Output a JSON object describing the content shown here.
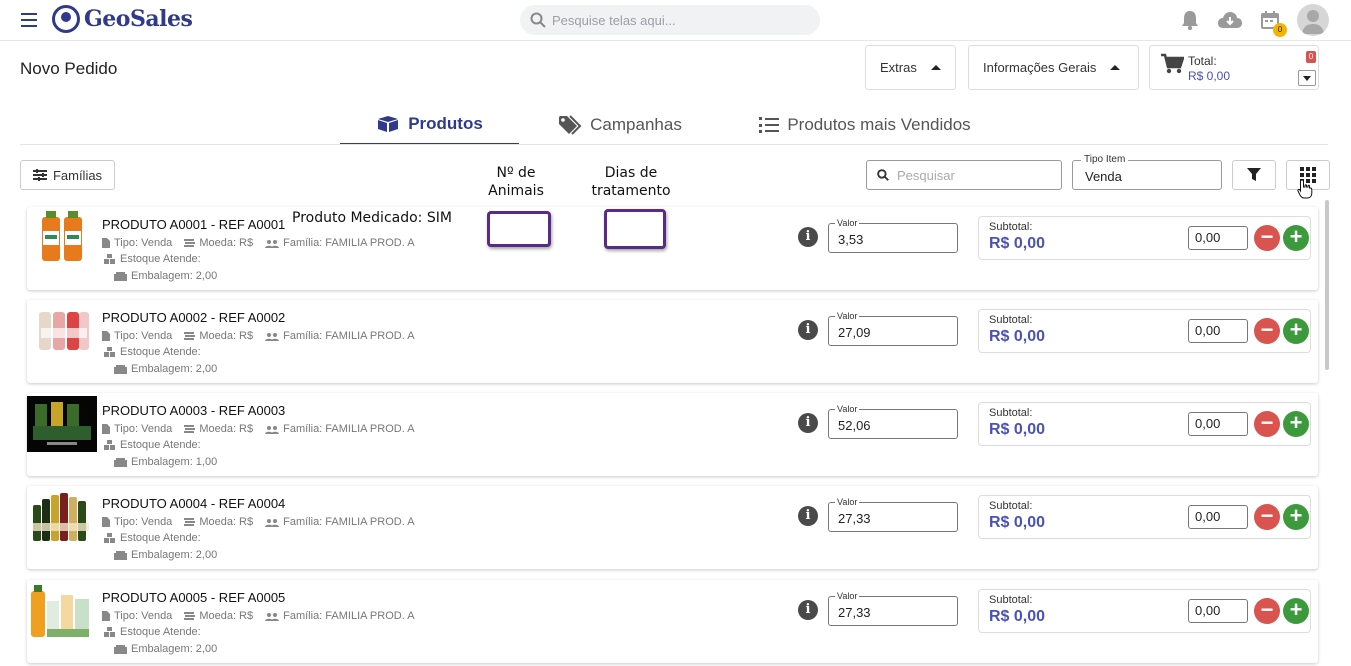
{
  "app": {
    "logo_text": "GeoSales"
  },
  "top": {
    "search_placeholder": "Pesquise telas aqui...",
    "calendar_badge": "0"
  },
  "header": {
    "title": "Novo Pedido",
    "extras_label": "Extras",
    "info_label": "Informações Gerais",
    "total_label": "Total:",
    "total_value": "R$ 0,00",
    "cart_count": "0"
  },
  "tabs": [
    {
      "label": "Produtos",
      "active": true
    },
    {
      "label": "Campanhas",
      "active": false
    },
    {
      "label": "Produtos mais Vendidos",
      "active": false
    }
  ],
  "filters": {
    "familias_label": "Famílias",
    "search_placeholder": "Pesquisar",
    "tipo_label": "Tipo Item",
    "tipo_value": "Venda"
  },
  "annotations": {
    "animals_label": "Nº de Animais",
    "treatment_label": "Dias de tratamento",
    "medicated_label": "Produto Medicado: SIM"
  },
  "products": [
    {
      "name": "PRODUTO A0001 - REF A0001",
      "tipo": "Tipo: Venda",
      "moeda": "Moeda: R$",
      "familia": "Família: FAMILIA PROD. A",
      "estoque": "Estoque Atende:",
      "embalagem": "Embalagem: 2,00",
      "valor_label": "Valor",
      "valor": "3,53",
      "subtotal_label": "Subtotal:",
      "subtotal": "R$ 0,00",
      "qty": "0,00"
    },
    {
      "name": "PRODUTO A0002 - REF A0002",
      "tipo": "Tipo: Venda",
      "moeda": "Moeda: R$",
      "familia": "Família: FAMILIA PROD. A",
      "estoque": "Estoque Atende:",
      "embalagem": "Embalagem: 2,00",
      "valor_label": "Valor",
      "valor": "27,09",
      "subtotal_label": "Subtotal:",
      "subtotal": "R$ 0,00",
      "qty": "0,00"
    },
    {
      "name": "PRODUTO A0003 - REF A0003",
      "tipo": "Tipo: Venda",
      "moeda": "Moeda: R$",
      "familia": "Família: FAMILIA PROD. A",
      "estoque": "Estoque Atende:",
      "embalagem": "Embalagem: 1,00",
      "valor_label": "Valor",
      "valor": "52,06",
      "subtotal_label": "Subtotal:",
      "subtotal": "R$ 0,00",
      "qty": "0,00"
    },
    {
      "name": "PRODUTO A0004 - REF A0004",
      "tipo": "Tipo: Venda",
      "moeda": "Moeda: R$",
      "familia": "Família: FAMILIA PROD. A",
      "estoque": "Estoque Atende:",
      "embalagem": "Embalagem: 2,00",
      "valor_label": "Valor",
      "valor": "27,33",
      "subtotal_label": "Subtotal:",
      "subtotal": "R$ 0,00",
      "qty": "0,00"
    },
    {
      "name": "PRODUTO A0005 - REF A0005",
      "tipo": "Tipo: Venda",
      "moeda": "Moeda: R$",
      "familia": "Família: FAMILIA PROD. A",
      "estoque": "Estoque Atende:",
      "embalagem": "Embalagem: 2,00",
      "valor_label": "Valor",
      "valor": "27,33",
      "subtotal_label": "Subtotal:",
      "subtotal": "R$ 0,00",
      "qty": "0,00"
    }
  ],
  "colors": {
    "brand": "#2f3a8c",
    "accent": "#4a52b5",
    "minus": "#d9534f",
    "plus": "#3c9a3c",
    "annotation_border": "#5b2a86"
  }
}
